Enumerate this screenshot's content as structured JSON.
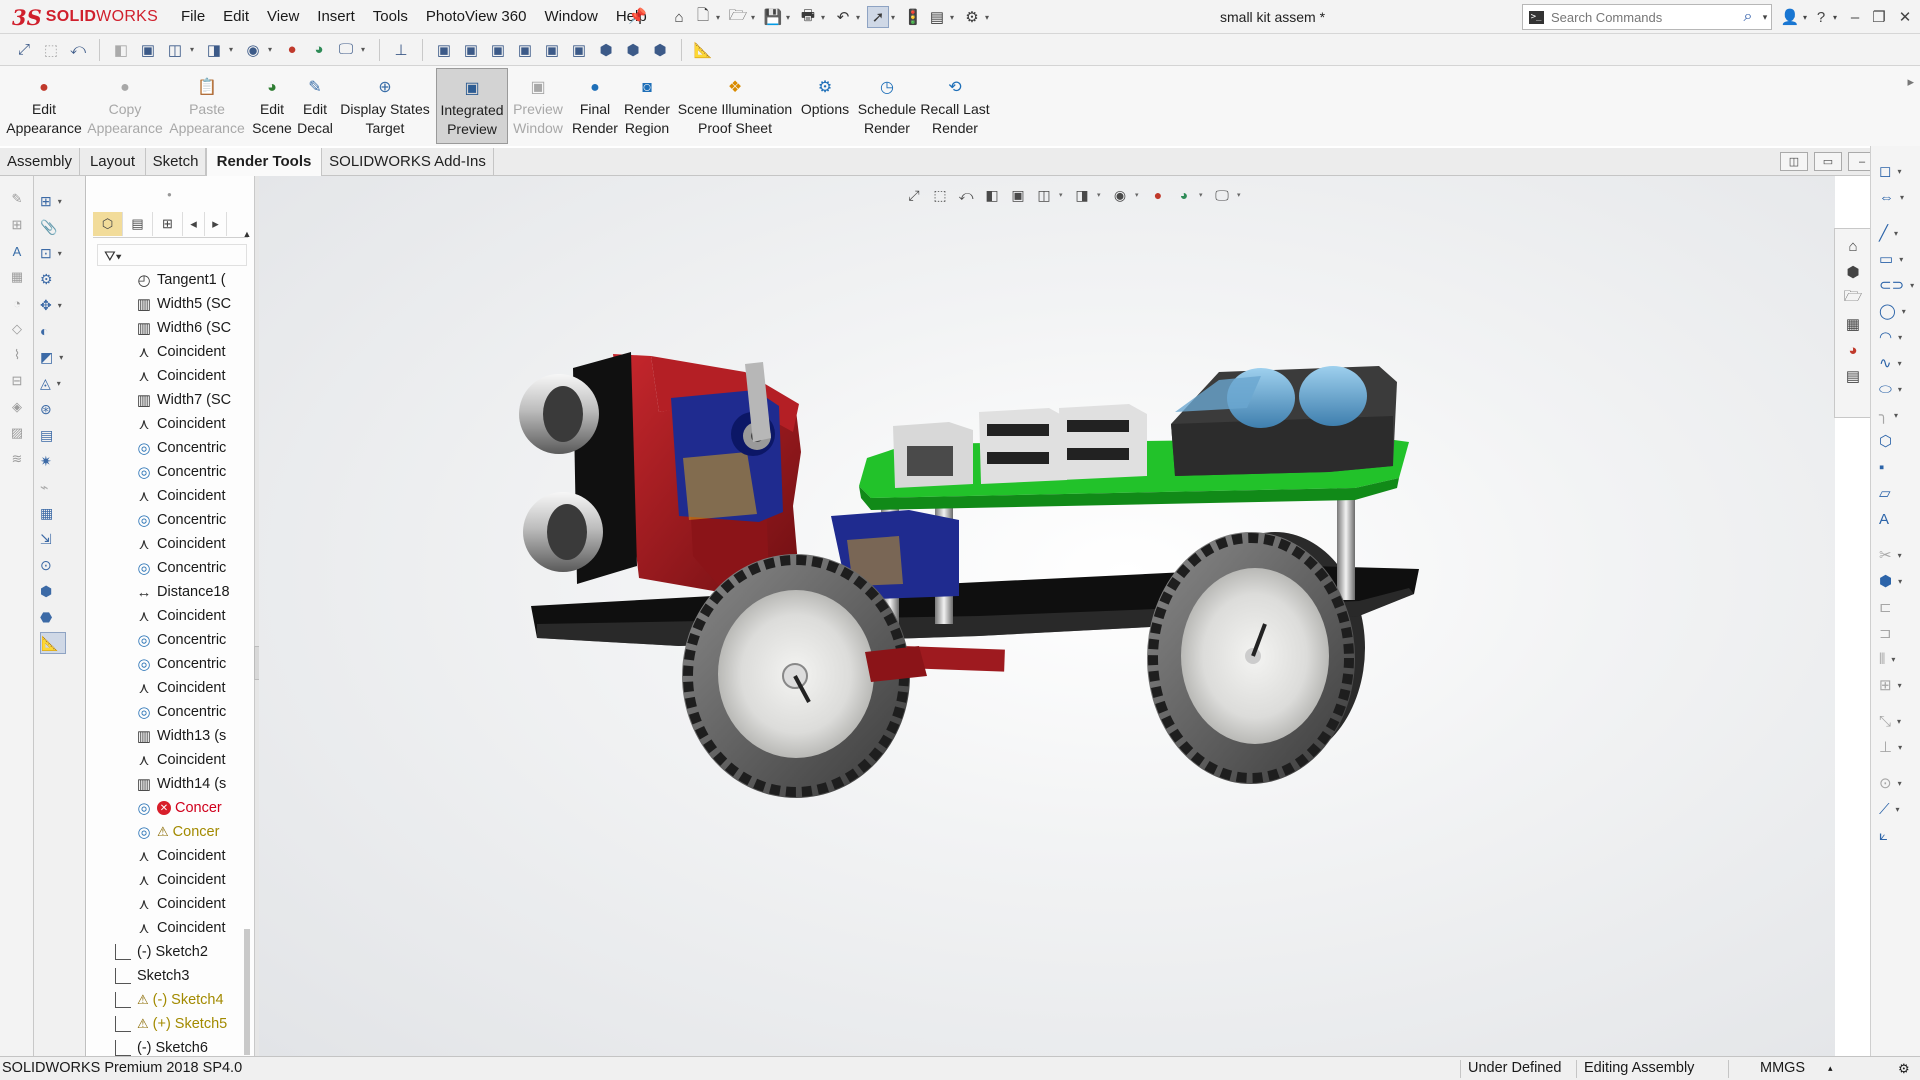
{
  "app": {
    "logo_ds": "3S",
    "logo_text_a": "SOLID",
    "logo_text_b": "WORKS",
    "document_title": "small kit assem *",
    "search_placeholder": "Search Commands"
  },
  "menu": [
    "File",
    "Edit",
    "View",
    "Insert",
    "Tools",
    "PhotoView 360",
    "Window",
    "Help"
  ],
  "ribbon": {
    "buttons": [
      {
        "line1": "Edit",
        "line2": "Appearance",
        "enabled": true
      },
      {
        "line1": "Copy",
        "line2": "Appearance",
        "enabled": false
      },
      {
        "line1": "Paste",
        "line2": "Appearance",
        "enabled": false
      },
      {
        "line1": "Edit",
        "line2": "Scene",
        "enabled": true
      },
      {
        "line1": "Edit",
        "line2": "Decal",
        "enabled": true
      },
      {
        "line1": "Display States",
        "line2": "Target",
        "enabled": true
      },
      {
        "line1": "Integrated",
        "line2": "Preview",
        "enabled": true,
        "active": true
      },
      {
        "line1": "Preview",
        "line2": "Window",
        "enabled": false
      },
      {
        "line1": "Final",
        "line2": "Render",
        "enabled": true
      },
      {
        "line1": "Render",
        "line2": "Region",
        "enabled": true
      },
      {
        "line1": "Scene Illumination",
        "line2": "Proof Sheet",
        "enabled": true
      },
      {
        "line1": "Options",
        "line2": "",
        "enabled": true
      },
      {
        "line1": "Schedule",
        "line2": "Render",
        "enabled": true
      },
      {
        "line1": "Recall Last",
        "line2": "Render",
        "enabled": true
      }
    ]
  },
  "tabs": [
    "Assembly",
    "Layout",
    "Sketch",
    "Render Tools",
    "SOLIDWORKS Add-Ins"
  ],
  "active_tab": "Render Tools",
  "tree": {
    "items": [
      {
        "icon": "tangent",
        "label": "Tangent1 ("
      },
      {
        "icon": "width",
        "label": "Width5 (SC"
      },
      {
        "icon": "width",
        "label": "Width6 (SC"
      },
      {
        "icon": "coincident",
        "label": "Coincident"
      },
      {
        "icon": "coincident",
        "label": "Coincident"
      },
      {
        "icon": "width",
        "label": "Width7 (SC"
      },
      {
        "icon": "coincident",
        "label": "Coincident"
      },
      {
        "icon": "concentric",
        "label": "Concentric"
      },
      {
        "icon": "concentric",
        "label": "Concentric"
      },
      {
        "icon": "coincident",
        "label": "Coincident"
      },
      {
        "icon": "concentric",
        "label": "Concentric"
      },
      {
        "icon": "coincident",
        "label": "Coincident"
      },
      {
        "icon": "concentric",
        "label": "Concentric"
      },
      {
        "icon": "distance",
        "label": "Distance18"
      },
      {
        "icon": "coincident",
        "label": "Coincident"
      },
      {
        "icon": "concentric",
        "label": "Concentric"
      },
      {
        "icon": "concentric",
        "label": "Concentric"
      },
      {
        "icon": "coincident",
        "label": "Coincident"
      },
      {
        "icon": "concentric",
        "label": "Concentric"
      },
      {
        "icon": "width",
        "label": "Width13 (s"
      },
      {
        "icon": "coincident",
        "label": "Coincident"
      },
      {
        "icon": "width",
        "label": "Width14 (s"
      },
      {
        "icon": "concentric",
        "label": "Concer",
        "state": "error"
      },
      {
        "icon": "concentric",
        "label": "Concer",
        "state": "warning"
      },
      {
        "icon": "coincident",
        "label": "Coincident"
      },
      {
        "icon": "coincident",
        "label": "Coincident"
      },
      {
        "icon": "coincident",
        "label": "Coincident"
      },
      {
        "icon": "coincident",
        "label": "Coincident"
      }
    ],
    "sketches": [
      {
        "label": "(-) Sketch2",
        "state": "normal"
      },
      {
        "label": "Sketch3",
        "state": "normal"
      },
      {
        "label": "(-) Sketch4",
        "state": "warning"
      },
      {
        "label": "(+) Sketch5",
        "state": "warning"
      },
      {
        "label": "(-) Sketch6",
        "state": "normal"
      }
    ]
  },
  "status": {
    "product": "SOLIDWORKS Premium 2018 SP4.0",
    "definition": "Under Defined",
    "mode": "Editing Assembly",
    "units": "MMGS"
  },
  "colors": {
    "brand": "#d01f2c",
    "chassis": "#111111",
    "bracket_red": "#9e1a1f",
    "pcb_green": "#22c22a",
    "servo_blue": "#1f2b8f",
    "battery_blue": "#6aa6cf"
  }
}
